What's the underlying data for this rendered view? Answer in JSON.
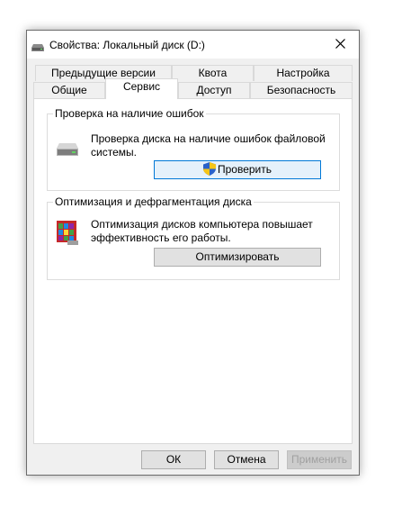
{
  "window": {
    "title": "Свойства: Локальный диск (D:)"
  },
  "tabs_row1": [
    {
      "label": "Предыдущие версии"
    },
    {
      "label": "Квота"
    },
    {
      "label": "Настройка"
    }
  ],
  "tabs_row2": [
    {
      "label": "Общие"
    },
    {
      "label": "Сервис",
      "active": true
    },
    {
      "label": "Доступ"
    },
    {
      "label": "Безопасность"
    }
  ],
  "error_check": {
    "title": "Проверка на наличие ошибок",
    "description": "Проверка диска на наличие ошибок файловой системы.",
    "button_label": "Проверить",
    "icon": "drive-icon"
  },
  "optimize": {
    "title": "Оптимизация и дефрагментация диска",
    "description": "Оптимизация дисков компьютера повышает эффективность его работы.",
    "button_label": "Оптимизировать",
    "icon": "defrag-icon"
  },
  "footer": {
    "ok_label": "ОК",
    "cancel_label": "Отмена",
    "apply_label": "Применить"
  },
  "colors": {
    "window_bg": "#f0f0f0",
    "focus_border": "#0078d7",
    "focus_bg": "#e5f1fb",
    "disabled_text": "#a0a0a0"
  }
}
